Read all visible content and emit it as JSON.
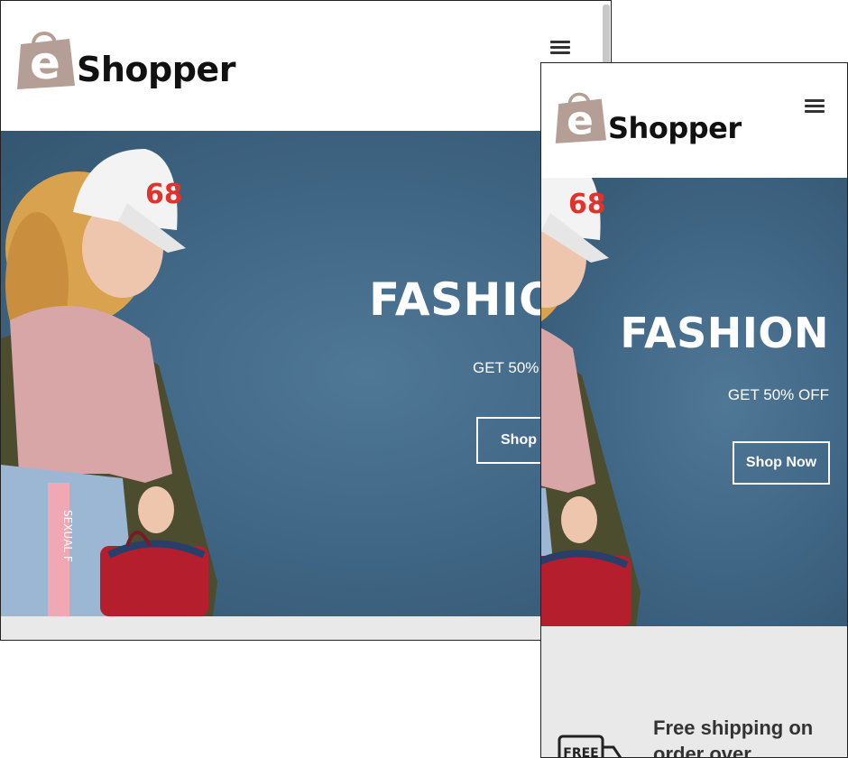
{
  "brand": {
    "logo_letter": "e",
    "logo_name": "Shopper"
  },
  "hero": {
    "title": "FASHION",
    "title_clipped": "FASHIO",
    "subtitle": "GET 50% OFF",
    "subtitle_clipped": "GET 50%",
    "cta_label": "Shop Now",
    "cta_label_clipped": "Shop N",
    "cap_number": "68",
    "pants_print": "SEXUAL F"
  },
  "features": {
    "shipping_text": "Free shipping on order over",
    "shipping_icon_label": "FREE"
  },
  "colors": {
    "hero_bg": "#3f6584",
    "logo_bag": "#b49e96",
    "text_dark": "#111111",
    "band": "#e9e9e9"
  },
  "icons": {
    "menu": "hamburger-menu-icon",
    "logo": "shopping-bag-icon",
    "shipping": "delivery-truck-icon"
  }
}
